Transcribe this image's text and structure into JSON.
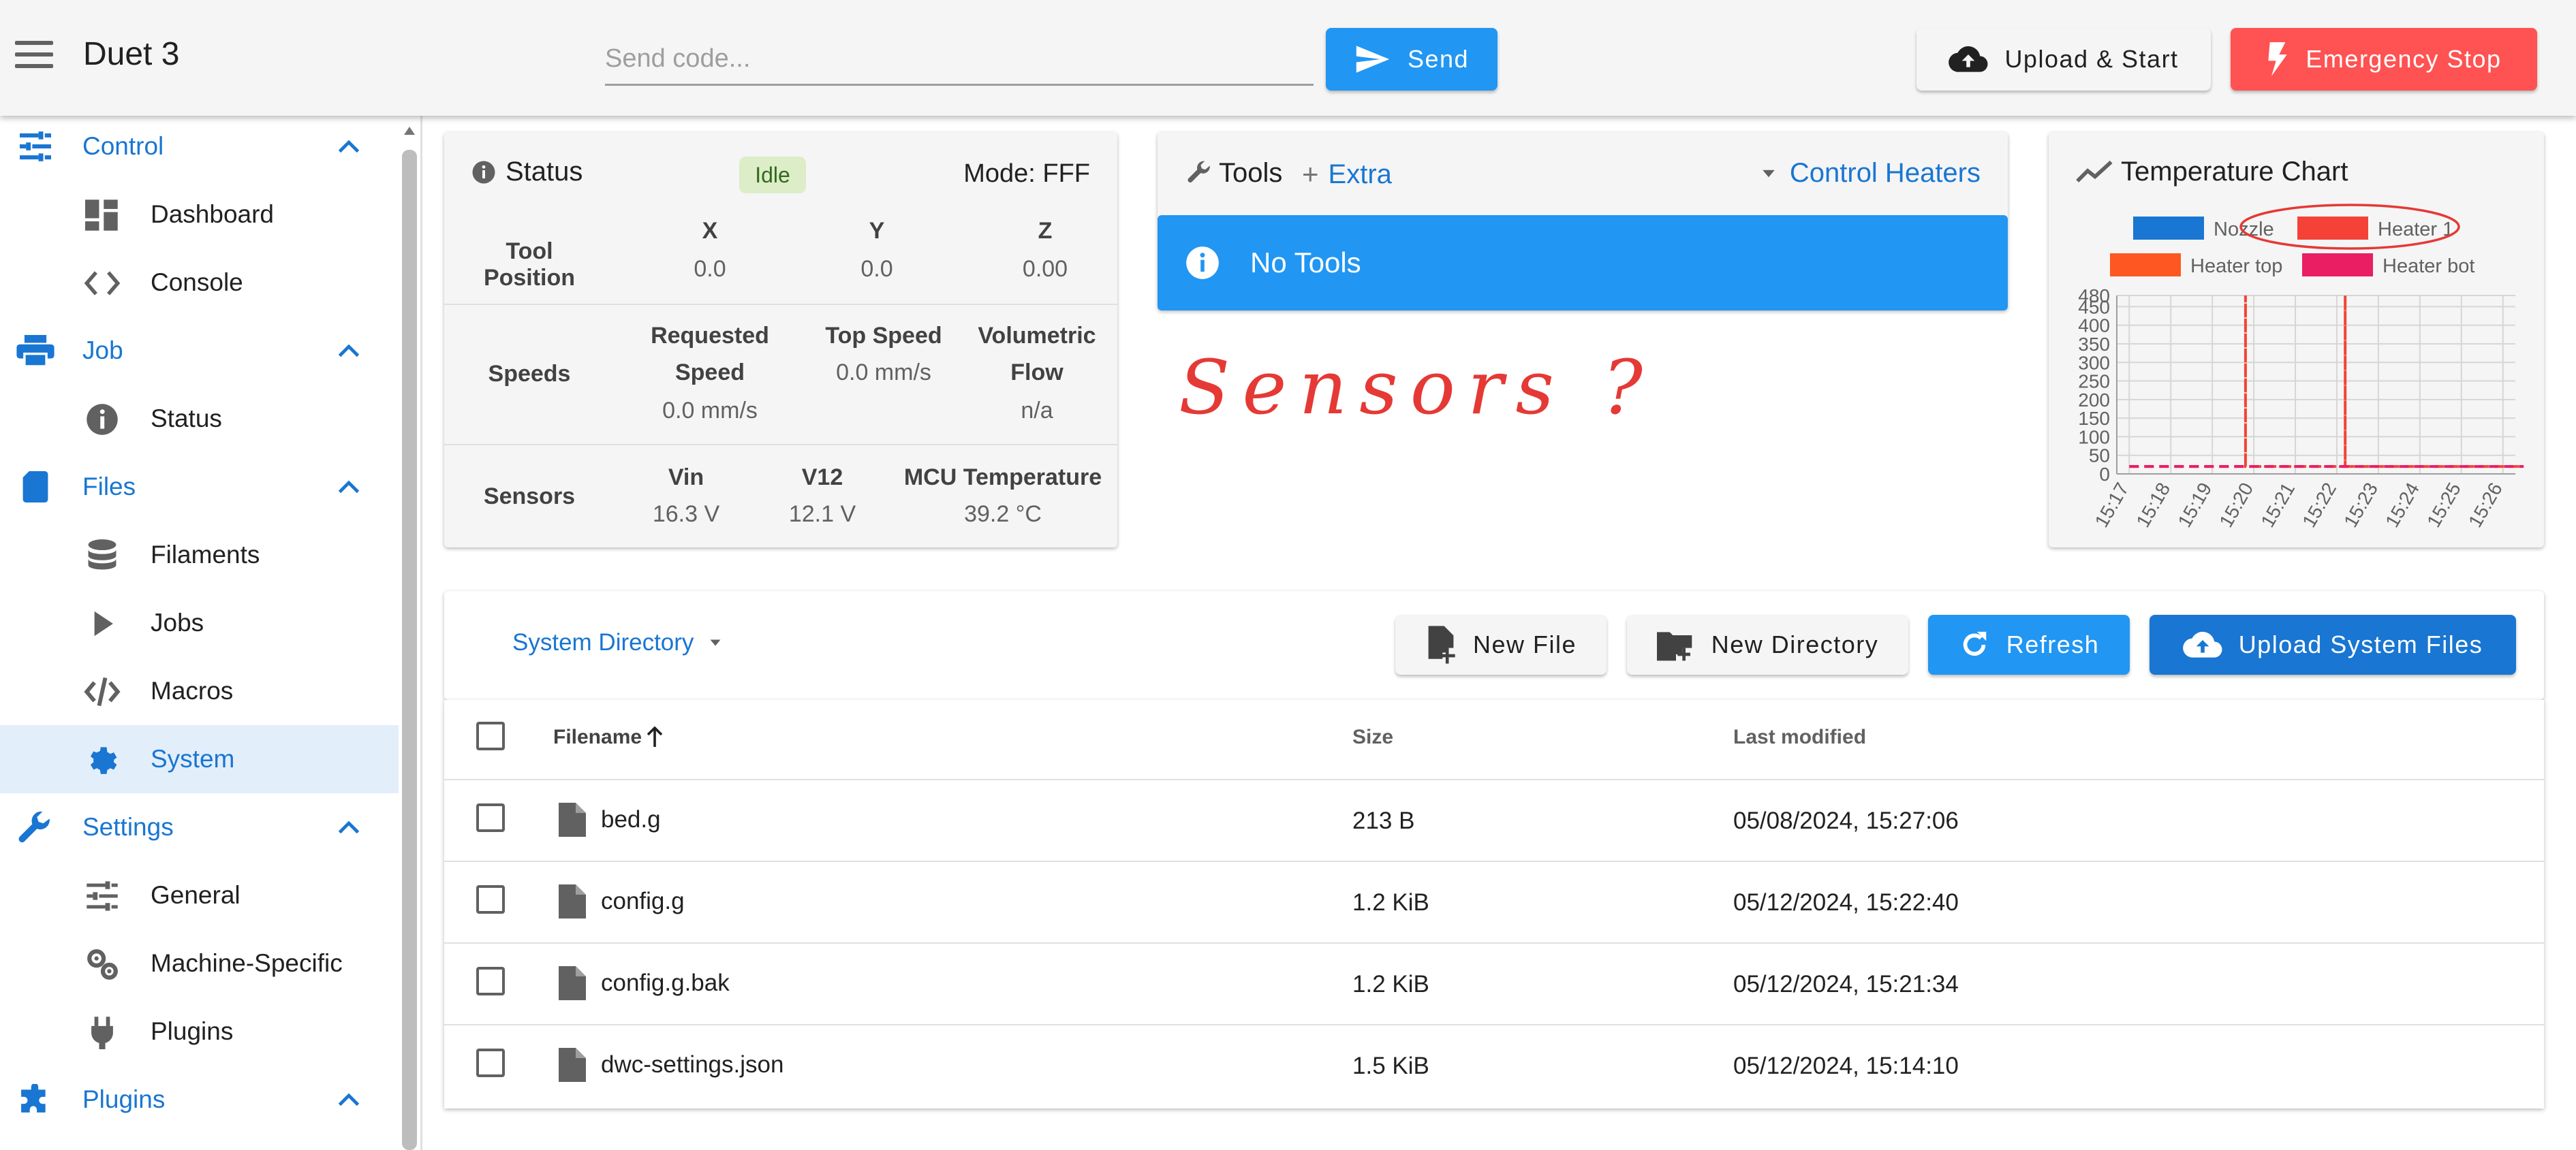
{
  "app": {
    "title": "Duet 3"
  },
  "topbar": {
    "code_placeholder": "Send code...",
    "send_label": "Send",
    "upload_start_label": "Upload & Start",
    "emergency_label": "Emergency Stop"
  },
  "sidebar": {
    "groups": [
      {
        "label": "Control",
        "icon": "tune-icon",
        "items": [
          {
            "label": "Dashboard",
            "icon": "dashboard-icon"
          },
          {
            "label": "Console",
            "icon": "code-icon"
          }
        ]
      },
      {
        "label": "Job",
        "icon": "printer-icon",
        "items": [
          {
            "label": "Status",
            "icon": "info-icon"
          }
        ]
      },
      {
        "label": "Files",
        "icon": "sd-card-icon",
        "items": [
          {
            "label": "Filaments",
            "icon": "database-icon"
          },
          {
            "label": "Jobs",
            "icon": "play-icon"
          },
          {
            "label": "Macros",
            "icon": "code-slash-icon"
          },
          {
            "label": "System",
            "icon": "gear-icon",
            "active": true
          }
        ]
      },
      {
        "label": "Settings",
        "icon": "wrench-icon",
        "items": [
          {
            "label": "General",
            "icon": "tune-icon"
          },
          {
            "label": "Machine-Specific",
            "icon": "gears-icon"
          },
          {
            "label": "Plugins",
            "icon": "plug-icon"
          }
        ]
      },
      {
        "label": "Plugins",
        "icon": "puzzle-icon",
        "items": []
      }
    ]
  },
  "status": {
    "title": "Status",
    "badge": "Idle",
    "mode": "Mode: FFF",
    "tool_position": {
      "label": "Tool Position",
      "axes": [
        {
          "name": "X",
          "value": "0.0"
        },
        {
          "name": "Y",
          "value": "0.0"
        },
        {
          "name": "Z",
          "value": "0.00"
        }
      ]
    },
    "speeds": {
      "label": "Speeds",
      "requested_label": "Requested Speed",
      "requested_label_1": "Requested",
      "requested_label_2": "Speed",
      "requested_value": "0.0 mm/s",
      "top_label": "Top Speed",
      "top_value": "0.0 mm/s",
      "volumetric_label_1": "Volumetric",
      "volumetric_label_2": "Flow",
      "volumetric_value": "n/a"
    },
    "sensors": {
      "label": "Sensors",
      "vin_label": "Vin",
      "vin_value": "16.3 V",
      "v12_label": "V12",
      "v12_value": "12.1 V",
      "mcu_label": "MCU Temperature",
      "mcu_value": "39.2 °C"
    }
  },
  "tools": {
    "title": "Tools",
    "extra_label": "Extra",
    "control_heaters_label": "Control Heaters",
    "no_tools": "No Tools"
  },
  "annotations": {
    "sensors_note": "Sensors ?",
    "chart_note": "??"
  },
  "chart": {
    "title": "Temperature Chart"
  },
  "chart_data": {
    "type": "line",
    "title": "Temperature Chart",
    "x": [
      "15:17",
      "15:18",
      "15:19",
      "15:20",
      "15:21",
      "15:22",
      "15:23",
      "15:24",
      "15:25",
      "15:26"
    ],
    "ylim": [
      0,
      480
    ],
    "yticks": [
      0,
      50,
      100,
      150,
      200,
      250,
      300,
      350,
      400,
      450,
      480
    ],
    "grid": true,
    "legend_position": "top",
    "series": [
      {
        "name": "Nozzle",
        "color": "#1976d2",
        "values": []
      },
      {
        "name": "Heater 1",
        "color": "#f44336",
        "dashed": true,
        "points": [
          [
            "15:17",
            20
          ],
          [
            "15:19.8",
            20
          ],
          [
            "15:19.8",
            480
          ],
          [
            "15:19.8",
            20
          ],
          [
            "15:22.2",
            20
          ],
          [
            "15:22.2",
            480
          ],
          [
            "15:22.2",
            20
          ],
          [
            "15:26.5",
            20
          ]
        ]
      },
      {
        "name": "Heater top",
        "color": "#ff5722",
        "dashed": true,
        "values": []
      },
      {
        "name": "Heater bot",
        "color": "#e91e63",
        "dashed": true,
        "points": [
          [
            "15:17",
            20
          ],
          [
            "15:26.5",
            20
          ]
        ]
      }
    ]
  },
  "files": {
    "directory_label": "System Directory",
    "new_file_label": "New File",
    "new_directory_label": "New Directory",
    "refresh_label": "Refresh",
    "upload_label": "Upload System Files",
    "columns": {
      "filename": "Filename",
      "size": "Size",
      "modified": "Last modified"
    },
    "rows": [
      {
        "name": "bed.g",
        "size": "213 B",
        "modified": "05/08/2024, 15:27:06"
      },
      {
        "name": "config.g",
        "size": "1.2 KiB",
        "modified": "05/12/2024, 15:22:40"
      },
      {
        "name": "config.g.bak",
        "size": "1.2 KiB",
        "modified": "05/12/2024, 15:21:34"
      },
      {
        "name": "dwc-settings.json",
        "size": "1.5 KiB",
        "modified": "05/12/2024, 15:14:10"
      }
    ]
  }
}
